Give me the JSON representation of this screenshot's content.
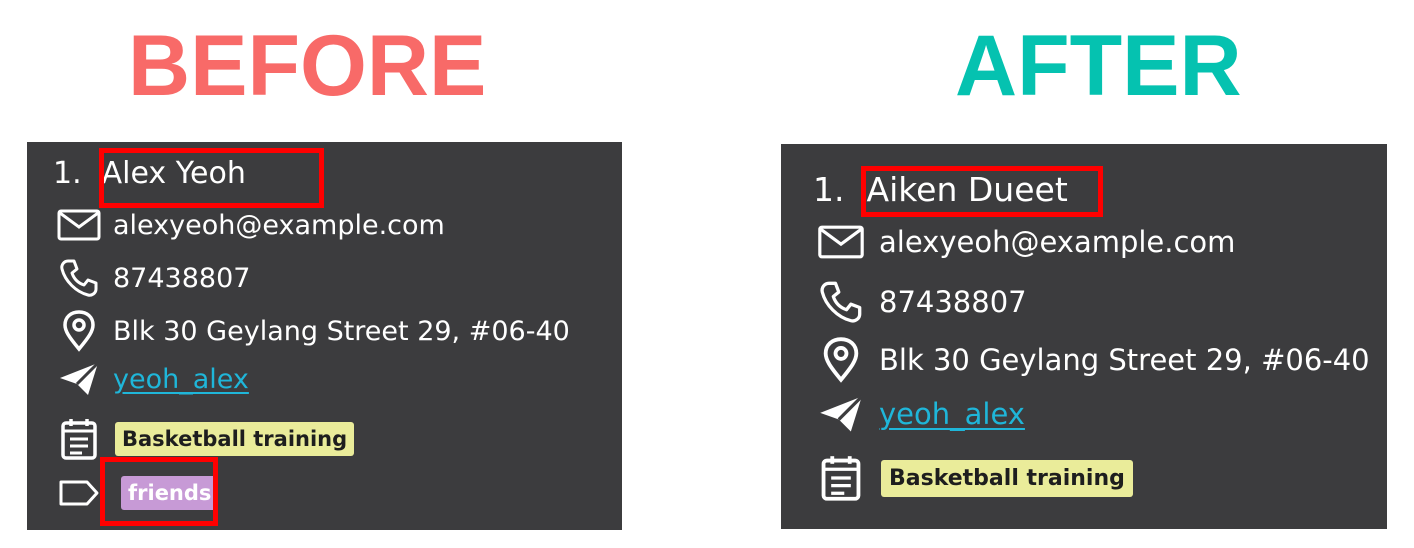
{
  "headings": {
    "before": "BEFORE",
    "after": "AFTER"
  },
  "colors": {
    "before_heading": "#f86a68",
    "after_heading": "#05c2b0",
    "card_bg": "#3c3c3e",
    "link": "#1fb6d9",
    "highlight": "#ff0000",
    "schedule_tag": "#eaec9a",
    "friends_tag": "#c79ad6"
  },
  "before": {
    "index": "1.",
    "name": "Alex Yeoh",
    "email": "alexyeoh@example.com",
    "phone": "87438807",
    "address": "Blk 30 Geylang Street 29, #06-40",
    "telegram": "yeoh_alex",
    "schedule": "Basketball training",
    "tags": [
      "friends"
    ],
    "icons": [
      "mail-icon",
      "phone-icon",
      "location-icon",
      "telegram-icon",
      "calendar-icon",
      "tag-icon"
    ]
  },
  "after": {
    "index": "1.",
    "name": "Aiken Dueet",
    "email": "alexyeoh@example.com",
    "phone": "87438807",
    "address": "Blk 30 Geylang Street 29, #06-40",
    "telegram": "yeoh_alex",
    "schedule": "Basketball training",
    "icons": [
      "mail-icon",
      "phone-icon",
      "location-icon",
      "telegram-icon",
      "calendar-icon"
    ]
  }
}
